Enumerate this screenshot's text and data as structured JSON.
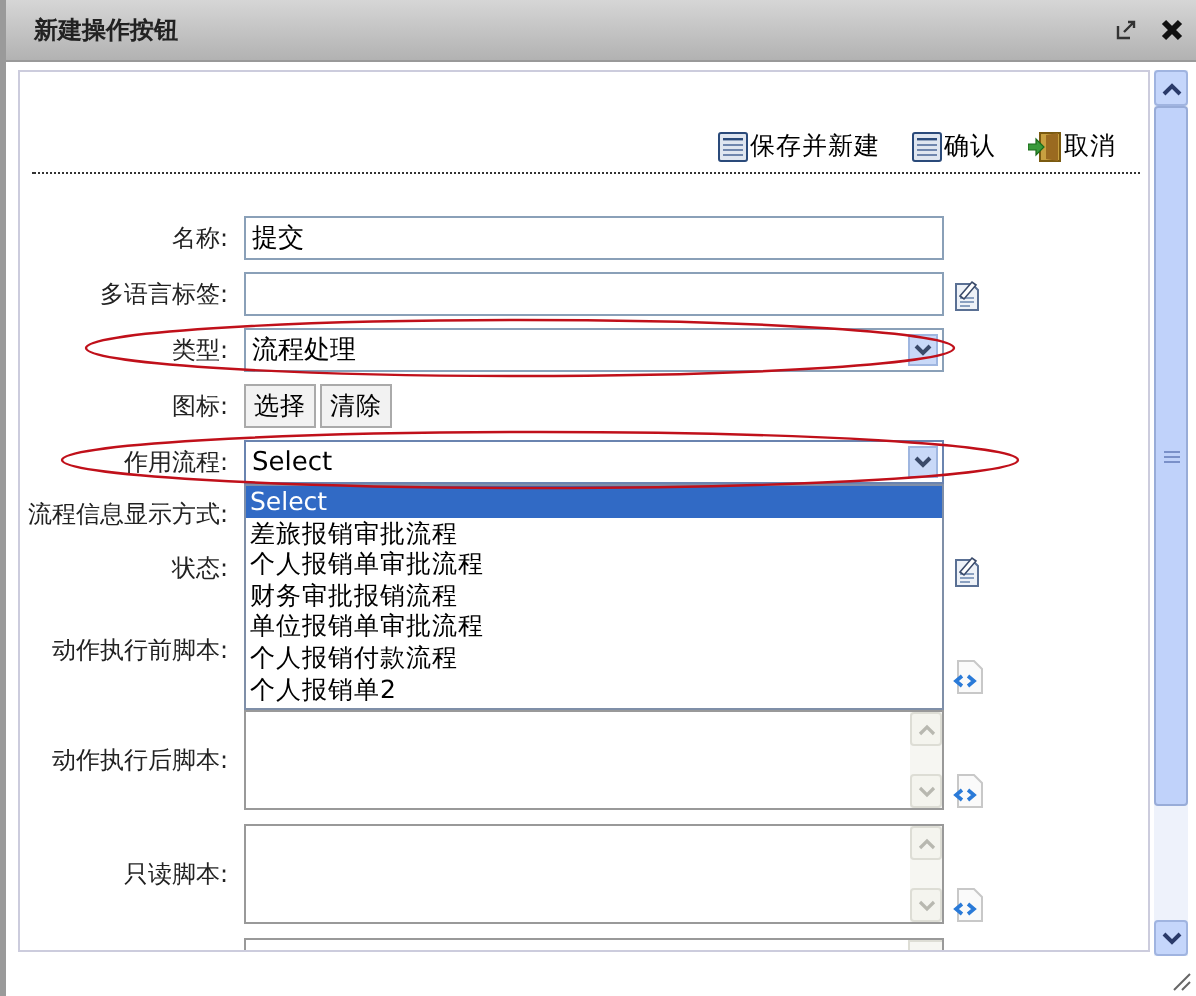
{
  "window": {
    "title": "新建操作按钮"
  },
  "toolbar": [
    {
      "kind": "save",
      "label": "保存并新建"
    },
    {
      "kind": "save",
      "label": "确认"
    },
    {
      "kind": "exit",
      "label": "取消"
    }
  ],
  "form": {
    "rows": [
      {
        "kind": "text",
        "label": "名称:",
        "value": "提交"
      },
      {
        "kind": "text-note",
        "label": "多语言标签:"
      },
      {
        "kind": "select",
        "label": "类型:",
        "value": "流程处理"
      },
      {
        "kind": "buttons",
        "label": "图标:",
        "buttons": [
          "选择",
          "清除"
        ]
      },
      {
        "kind": "select",
        "label": "作用流程:",
        "value": "Select",
        "expanded": true,
        "options": [
          {
            "label": "Select",
            "selected": true
          },
          {
            "label": "差旅报销审批流程",
            "selected": false
          },
          {
            "label": "个人报销单审批流程",
            "selected": false
          },
          {
            "label": "财务审批报销流程",
            "selected": false
          },
          {
            "label": "单位报销单审批流程",
            "selected": false
          },
          {
            "label": "个人报销付款流程",
            "selected": false
          },
          {
            "label": "个人报销单2",
            "selected": false
          }
        ]
      },
      {
        "kind": "covered",
        "label": "流程信息显示方式:"
      },
      {
        "kind": "covered-note",
        "label": "状态:"
      },
      {
        "kind": "covered-textarea",
        "label": "动作执行前脚本:"
      },
      {
        "kind": "textarea",
        "label": "动作执行后脚本:"
      },
      {
        "kind": "textarea",
        "label": "只读脚本:"
      },
      {
        "kind": "textarea-cut"
      }
    ]
  }
}
